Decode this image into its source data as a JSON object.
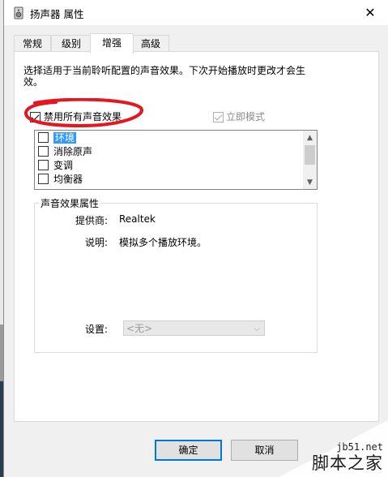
{
  "window": {
    "title": "扬声器 属性",
    "close_glyph": "✕"
  },
  "tabs": [
    {
      "label": "常规"
    },
    {
      "label": "级别"
    },
    {
      "label": "增强"
    },
    {
      "label": "高级"
    }
  ],
  "active_tab": "增强",
  "description": "选择适用于当前聆听配置的声音效果。下次开始播放时更改才会生效。",
  "disable_all": {
    "label": "禁用所有声音效果",
    "checked": true
  },
  "immediate_mode": {
    "label": "立即模式",
    "checked": true,
    "enabled": false
  },
  "effects": [
    {
      "label": "环境",
      "checked": false,
      "selected": true
    },
    {
      "label": "消除原声",
      "checked": false,
      "selected": false
    },
    {
      "label": "变调",
      "checked": false,
      "selected": false
    },
    {
      "label": "均衡器",
      "checked": false,
      "selected": false
    }
  ],
  "properties_group": {
    "title": "声音效果属性",
    "provider_label": "提供商:",
    "provider_value": "Realtek",
    "description_label": "说明:",
    "description_value": "模拟多个播放环境。",
    "settings_label": "设置:",
    "settings_value": "<无>"
  },
  "buttons": {
    "ok": "确定",
    "cancel": "取消"
  },
  "watermark": {
    "url": "jb51.net",
    "text": "脚本之家"
  },
  "colors": {
    "selection": "#3399ff",
    "annotation_circle": "#e8141e",
    "default_button_border": "#0078d7"
  }
}
